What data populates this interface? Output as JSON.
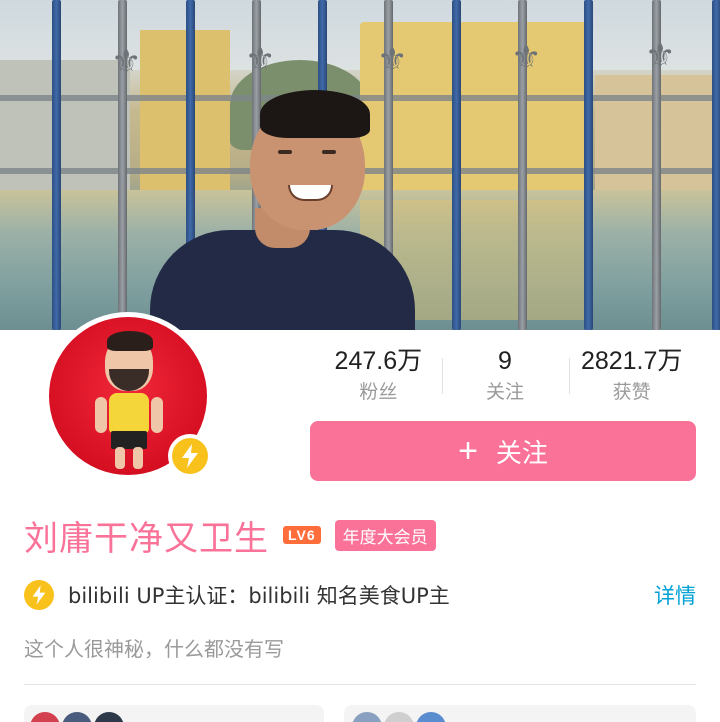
{
  "profile": {
    "username": "刘庸干净又卫生",
    "level": "LV6",
    "vip_badge": "年度大会员",
    "certification": "bilibili UP主认证：bilibili 知名美食UP主",
    "certification_detail_link": "详情",
    "bio": "这个人很神秘，什么都没有写"
  },
  "stats": [
    {
      "value": "247.6万",
      "label": "粉丝"
    },
    {
      "value": "9",
      "label": "关注"
    },
    {
      "value": "2821.7万",
      "label": "获赞"
    }
  ],
  "follow_button": {
    "icon": "+",
    "label": "关注"
  },
  "colors": {
    "brand_pink": "#fb7299",
    "link_blue": "#00a1d6",
    "verify_yellow": "#f9c11b",
    "level_orange": "#ff6d3b"
  },
  "icons": {
    "verify": "lightning-bolt-icon",
    "follow": "plus-icon"
  }
}
